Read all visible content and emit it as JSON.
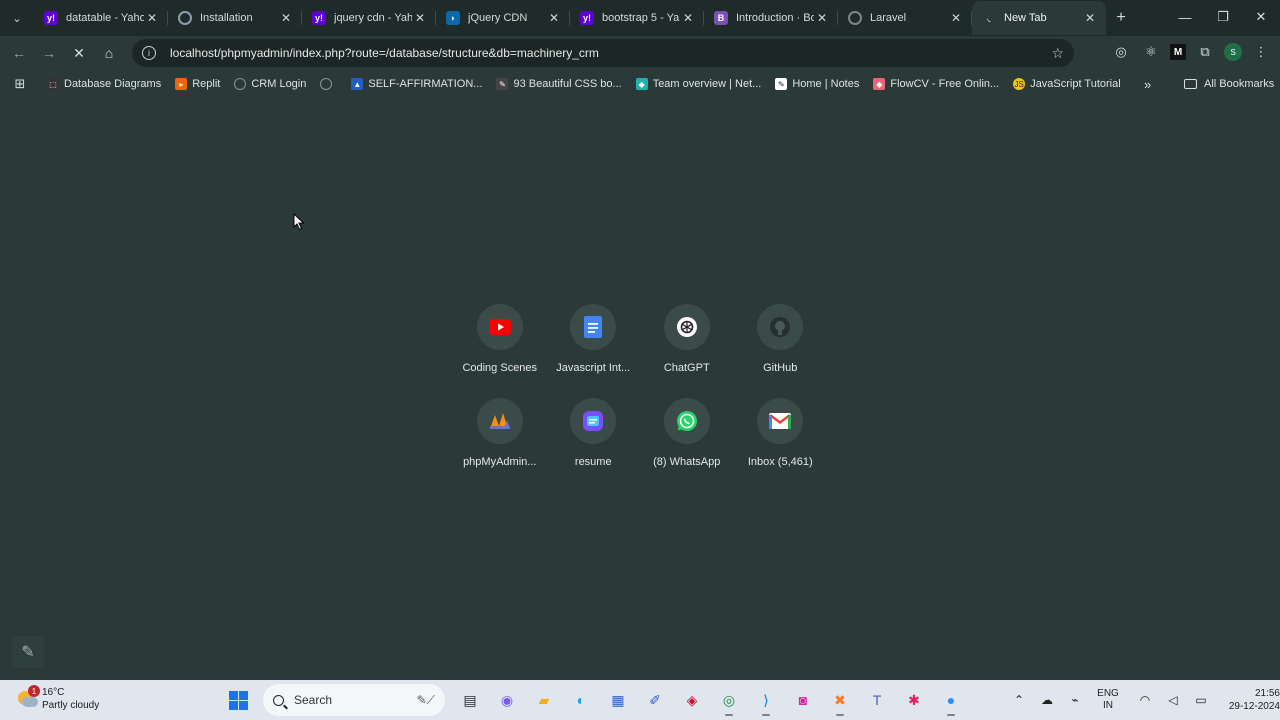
{
  "tabs": [
    {
      "title": "datatable - Yaho",
      "icon": "yahoo-icon",
      "color": "#6001d2",
      "glyph": "y!"
    },
    {
      "title": "Installation",
      "icon": "globe-icon",
      "color": "#8f9bb3",
      "glyph": ""
    },
    {
      "title": "jquery cdn - Yah",
      "icon": "yahoo-icon",
      "color": "#6001d2",
      "glyph": "y!"
    },
    {
      "title": "jQuery CDN",
      "icon": "jquery-icon",
      "color": "#0868ac",
      "glyph": "◗"
    },
    {
      "title": "bootstrap 5 - Ya",
      "icon": "yahoo-icon",
      "color": "#6001d2",
      "glyph": "y!"
    },
    {
      "title": "Introduction · Bo",
      "icon": "bootstrap-icon",
      "color": "#7952b3",
      "glyph": "B"
    },
    {
      "title": "Laravel",
      "icon": "globe-icon",
      "color": "#7a8786",
      "glyph": ""
    },
    {
      "title": "New Tab",
      "icon": "loading-icon",
      "color": "transparent",
      "glyph": "◟",
      "active": true
    }
  ],
  "close_glyph": "✕",
  "new_tab_glyph": "+",
  "window": {
    "minimize": "—",
    "restore": "❐",
    "close": "✕"
  },
  "nav": {
    "back": "←",
    "forward": "→",
    "stop": "✕",
    "home": "⌂"
  },
  "address": {
    "url": "localhost/phpmyadmin/index.php?route=/database/structure&db=machinery_crm",
    "info_glyph": "i",
    "star_glyph": "☆"
  },
  "extensions": {
    "ext1": "◎",
    "ext2": "⚛",
    "ext3": "M",
    "puzzle": "⧉",
    "profile": "S",
    "menu": "⋮"
  },
  "bookmarks": [
    {
      "label": "Database Diagrams",
      "icon": "diagram-icon",
      "color": "#333333",
      "glyph": "⬚"
    },
    {
      "label": "Replit",
      "icon": "replit-icon",
      "color": "#f26207",
      "glyph": "▸"
    },
    {
      "label": "CRM Login",
      "icon": "globe-icon",
      "color": "#8a9594",
      "glyph": ""
    },
    {
      "label": "",
      "icon": "globe-icon",
      "color": "#8a9594",
      "glyph": ""
    },
    {
      "label": "SELF-AFFIRMATION...",
      "icon": "bookmark-icon",
      "color": "#1f5fbf",
      "glyph": "▲"
    },
    {
      "label": "93 Beautiful CSS bo...",
      "icon": "css-icon",
      "color": "#444444",
      "glyph": "✎"
    },
    {
      "label": "Team overview | Net...",
      "icon": "netlify-icon",
      "color": "#20b2aa",
      "glyph": "◆"
    },
    {
      "label": "Home | Notes",
      "icon": "notes-icon",
      "color": "#ffffff",
      "glyph": "✎"
    },
    {
      "label": "FlowCV - Free Onlin...",
      "icon": "flowcv-icon",
      "color": "#e8667a",
      "glyph": "◆"
    },
    {
      "label": "JavaScript Tutorial",
      "icon": "js-icon",
      "color": "#f0c419",
      "glyph": "JS"
    }
  ],
  "bookmarks_more": "»",
  "all_bookmarks": "All Bookmarks",
  "apps_glyph": "⊞",
  "shortcuts": [
    {
      "label": "Coding Scenes",
      "icon": "youtube-icon"
    },
    {
      "label": "Javascript Int...",
      "icon": "docs-icon"
    },
    {
      "label": "ChatGPT",
      "icon": "chatgpt-icon"
    },
    {
      "label": "GitHub",
      "icon": "github-icon"
    },
    {
      "label": "phpMyAdmin...",
      "icon": "phpmyadmin-icon"
    },
    {
      "label": "resume",
      "icon": "resume-icon"
    },
    {
      "label": "(8) WhatsApp",
      "icon": "whatsapp-icon"
    },
    {
      "label": "Inbox (5,461)",
      "icon": "gmail-icon"
    }
  ],
  "customize_glyph": "✎",
  "taskbar": {
    "weather": {
      "temp": "16°C",
      "desc": "Partly cloudy",
      "badge": "1"
    },
    "search_label": "Search",
    "search_deco": "✎⟋",
    "apps": [
      {
        "name": "taskbar-file-explorer-icon",
        "glyph": "▤",
        "color": "#2a2a2a",
        "running": false
      },
      {
        "name": "taskbar-copilot-icon",
        "glyph": "◉",
        "color": "#7b5cf0",
        "running": false
      },
      {
        "name": "taskbar-folder-icon",
        "glyph": "▰",
        "color": "#f2b01e",
        "running": false
      },
      {
        "name": "taskbar-edge-icon",
        "glyph": "◐",
        "color": "#1b9de2",
        "running": false
      },
      {
        "name": "taskbar-store-icon",
        "glyph": "▦",
        "color": "#2a62c9",
        "running": false
      },
      {
        "name": "taskbar-pen-icon",
        "glyph": "✐",
        "color": "#3a56d4",
        "running": false
      },
      {
        "name": "taskbar-mcafee-icon",
        "glyph": "◈",
        "color": "#c8102e",
        "running": false
      },
      {
        "name": "taskbar-chrome-icon",
        "glyph": "◎",
        "color": "#1e8e3e",
        "running": true
      },
      {
        "name": "taskbar-vscode-icon",
        "glyph": "⟩",
        "color": "#0a7acc",
        "running": true
      },
      {
        "name": "taskbar-instagram-icon",
        "glyph": "◙",
        "color": "#d6249f",
        "running": false
      },
      {
        "name": "taskbar-xampp-icon",
        "glyph": "✖",
        "color": "#fb7a24",
        "running": true
      },
      {
        "name": "taskbar-teams-icon",
        "glyph": "T",
        "color": "#5059c9",
        "running": false
      },
      {
        "name": "taskbar-slack-icon",
        "glyph": "✱",
        "color": "#e01e5a",
        "running": false
      },
      {
        "name": "taskbar-zoom-icon",
        "glyph": "●",
        "color": "#2d8cff",
        "running": true
      }
    ],
    "tray": {
      "chevron": "⌃",
      "cloud": "☁",
      "network": "⌁",
      "wifi": "◠",
      "volume": "◁",
      "battery": "▭",
      "bell": "🔔"
    },
    "lang": {
      "top": "ENG",
      "bottom": "IN"
    },
    "clock": {
      "time": "21:56",
      "date": "29-12-2024"
    }
  }
}
